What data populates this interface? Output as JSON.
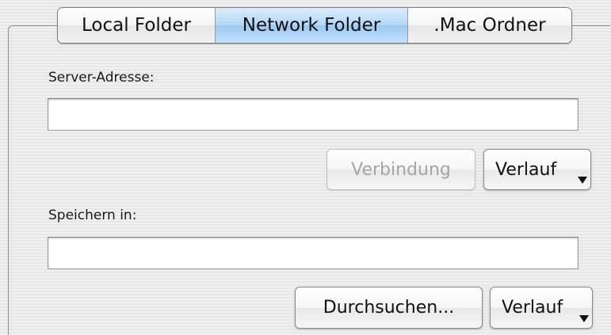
{
  "tabs": [
    {
      "label": "Local Folder",
      "active": false
    },
    {
      "label": "Network Folder",
      "active": true
    },
    {
      "label": ".Mac Ordner",
      "active": false
    }
  ],
  "server": {
    "label": "Server-Adresse:",
    "value": "",
    "placeholder": "",
    "connect_label": "Verbindung",
    "connect_enabled": false,
    "history_label": "Verlauf"
  },
  "save": {
    "label": "Speichern in:",
    "value": "",
    "placeholder": "",
    "browse_label": "Durchsuchen...",
    "history_label": "Verlauf"
  },
  "colors": {
    "active_tab": "#9bc8f1",
    "background": "#ececec"
  }
}
